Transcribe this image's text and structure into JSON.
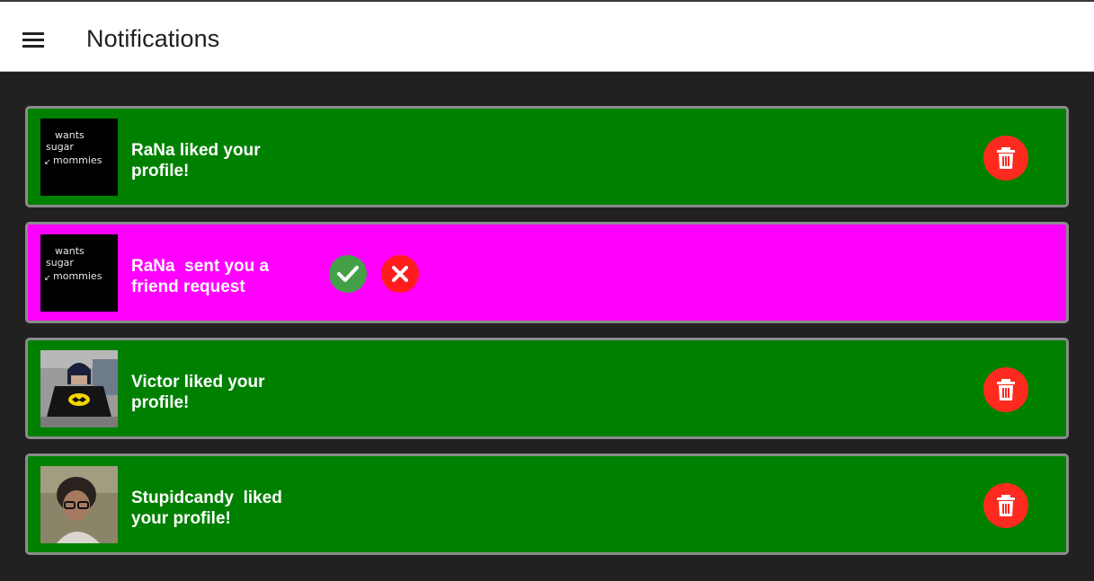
{
  "appbar": {
    "title": "Notifications",
    "menu_icon": "hamburger-menu-icon"
  },
  "colors": {
    "like_card": "#008000",
    "friend_request_card": "#ff00ff",
    "delete_button": "#ff2a1f",
    "accept_button": "#43a047",
    "decline_button": "#ff1c1c",
    "background": "#212121"
  },
  "notifications": [
    {
      "type": "like",
      "message": "RaNa liked your\nprofile!",
      "avatar_text": "wants sugar ↙ mommies",
      "action_icon": "trash-icon"
    },
    {
      "type": "friend_request",
      "message": "RaNa  sent you a\nfriend request",
      "avatar_text": "wants sugar ↙ mommies",
      "accept_icon": "check-icon",
      "decline_icon": "close-icon"
    },
    {
      "type": "like",
      "message": "Victor liked your\nprofile!",
      "avatar_desc": "batman-costume-photo",
      "action_icon": "trash-icon"
    },
    {
      "type": "like",
      "message": "Stupidcandy  liked\nyour profile!",
      "avatar_desc": "person-with-glasses-photo",
      "action_icon": "trash-icon"
    }
  ]
}
